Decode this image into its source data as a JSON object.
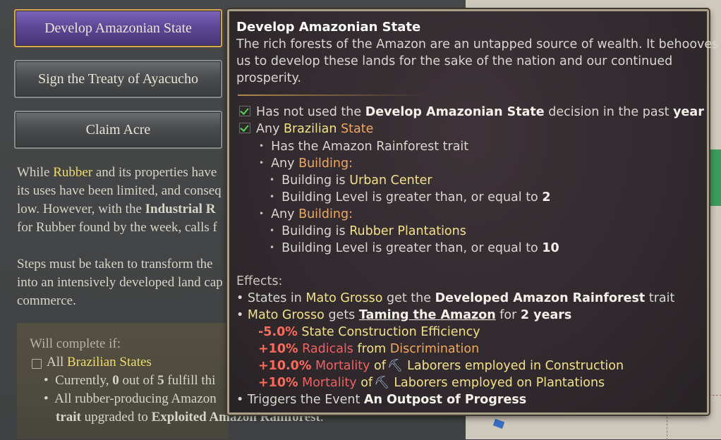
{
  "decisions": [
    {
      "label": "Develop Amazonian State",
      "selected": true
    },
    {
      "label": "Sign the Treaty of Ayacucho",
      "selected": false
    },
    {
      "label": "Claim Acre",
      "selected": false
    }
  ],
  "description": {
    "p1_l1_a": "While ",
    "p1_l1_hl": "Rubber",
    "p1_l1_b": " and its properties have",
    "p1_l2": "its uses have been limited, and conseq",
    "p1_l3_a": "low. However, with the ",
    "p1_l3_b": "Industrial R",
    "p1_l4": "for Rubber found by the week, calls f",
    "p2_l1": "Steps must be taken to transform the",
    "p2_l2": "into an intensively developed land cap",
    "p2_l3": "commerce."
  },
  "completion": {
    "title": "Will complete if:",
    "all_prefix": "All ",
    "all_hl": "Brazilian States",
    "b1_a": "Currently, ",
    "b1_n1": "0",
    "b1_b": " out of ",
    "b1_n2": "5",
    "b1_c": " fulfill thi",
    "b2": "All rubber-producing Amazon",
    "b3_a": "trait",
    "b3_b": " upgraded to ",
    "b3_c": "Exploited Amazon Rainforest",
    "b3_d": "."
  },
  "tooltip": {
    "title": "Develop Amazonian State",
    "desc1": "The rich forests of the Amazon are an untapped source of wealth. It behooves",
    "desc2": "us to develop these lands for the sake of the nation and our continued",
    "desc3": "prosperity.",
    "c1_a": "Has not used the ",
    "c1_b": "Develop Amazonian State",
    "c1_c": " decision in the past ",
    "c1_d": "year",
    "c2_a": "Any ",
    "c2_b": "Brazilian",
    "c2_c": " State",
    "c3": "Has the Amazon Rainforest trait",
    "c4_a": "Any ",
    "c4_b": "Building",
    "c5_a": "Building is ",
    "c5_b": "Urban Center",
    "c6_a": "Building Level is greater than, or equal to ",
    "c6_b": "2",
    "c7_a": "Any ",
    "c7_b": "Building",
    "c8_a": "Building is ",
    "c8_b": "Rubber Plantations",
    "c9_a": "Building Level is greater than, or equal to ",
    "c9_b": "10",
    "effects_label": "Effects:",
    "e1_a": "States in ",
    "e1_b": "Mato Grosso",
    "e1_c": " get the ",
    "e1_d": "Developed Amazon Rainforest",
    "e1_e": " trait",
    "e2_a": "Mato Grosso",
    "e2_b": " gets ",
    "e2_c": "Taming the Amazon",
    "e2_d": " for ",
    "e2_e": "2 years",
    "m1_a": "-5.0%",
    "m1_b": " State Construction Efficiency",
    "m2_a": "+10%",
    "m2_b": " Radicals",
    "m2_c": " from ",
    "m2_d": "Discrimination",
    "m3_a": "+10.0%",
    "m3_b": " Mortality",
    "m3_c": " of",
    "m3_d": "Laborers employed in Construction",
    "m4_a": "+10%",
    "m4_b": " Mortality",
    "m4_c": " of",
    "m4_d": "Laborers employed on Plantations",
    "e3_a": "Triggers the Event ",
    "e3_b": "An Outpost of Progress"
  },
  "colors": {
    "accent_purple": "#5b4694",
    "gold": "#d7a94a",
    "highlight_yellow": "#f3e188",
    "highlight_orange": "#f0a860",
    "negative_red": "#ee6262"
  },
  "icons": {
    "check": "checkmark-icon",
    "shovel": "shovel-icon",
    "bullet": "bullet-icon"
  }
}
